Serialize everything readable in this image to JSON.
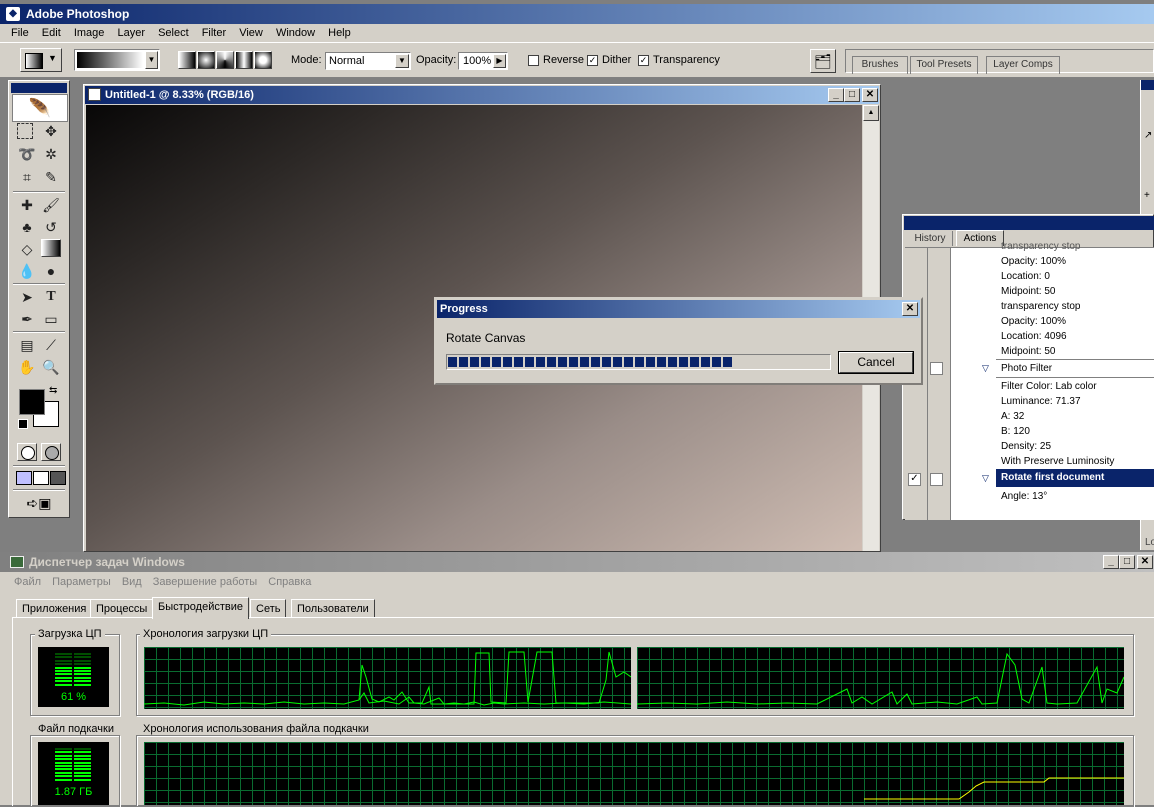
{
  "photoshop": {
    "app_title": "Adobe Photoshop",
    "menu": [
      "File",
      "Edit",
      "Image",
      "Layer",
      "Select",
      "Filter",
      "View",
      "Window",
      "Help"
    ],
    "options": {
      "mode_label": "Mode:",
      "mode_value": "Normal",
      "opacity_label": "Opacity:",
      "opacity_value": "100%",
      "reverse_label": "Reverse",
      "reverse_checked": false,
      "dither_label": "Dither",
      "dither_checked": true,
      "transparency_label": "Transparency",
      "transparency_checked": true
    },
    "palette_tabs": [
      "Brushes",
      "Tool Presets",
      "Layer Comps"
    ],
    "document_title": "Untitled-1 @ 8.33% (RGB/16)"
  },
  "progress": {
    "title": "Progress",
    "operation": "Rotate Canvas",
    "percent": 75,
    "cancel_label": "Cancel"
  },
  "actions_panel": {
    "tabs": [
      "History",
      "Actions"
    ],
    "active_tab": "Actions",
    "lines": [
      "transparency stop",
      "Opacity: 100%",
      "Location: 0",
      "Midpoint: 50",
      "transparency stop",
      "Opacity: 100%",
      "Location: 4096",
      "Midpoint: 50"
    ],
    "photo_filter_label": "Photo Filter",
    "photo_filter_lines": [
      "Filter Color: Lab color",
      "Luminance: 71.37",
      "A: 32",
      "B: 120",
      "Density: 25",
      "With Preserve Luminosity"
    ],
    "selected_label": "Rotate first document",
    "angle_line": "Angle: 13°",
    "right_edge_partial": "Lo"
  },
  "task_manager": {
    "title": "Диспетчер задач Windows",
    "menu": [
      "Файл",
      "Параметры",
      "Вид",
      "Завершение работы",
      "Справка"
    ],
    "tabs": [
      "Приложения",
      "Процессы",
      "Быстродействие",
      "Сеть",
      "Пользователи"
    ],
    "active_tab": "Быстродействие",
    "cpu_label": "Загрузка ЦП",
    "cpu_value": "61 %",
    "cpu_history_label": "Хронология загрузки ЦП",
    "pagefile_label": "Файл подкачки",
    "pagefile_value": "1.87 ГБ",
    "pagefile_history_label": "Хронология использования файла подкачки"
  },
  "colors": {
    "graph_line": "#00ff00",
    "pagefile_line": "#ffff00",
    "selected": "#0a246a",
    "progress_block": "#0a246a"
  }
}
